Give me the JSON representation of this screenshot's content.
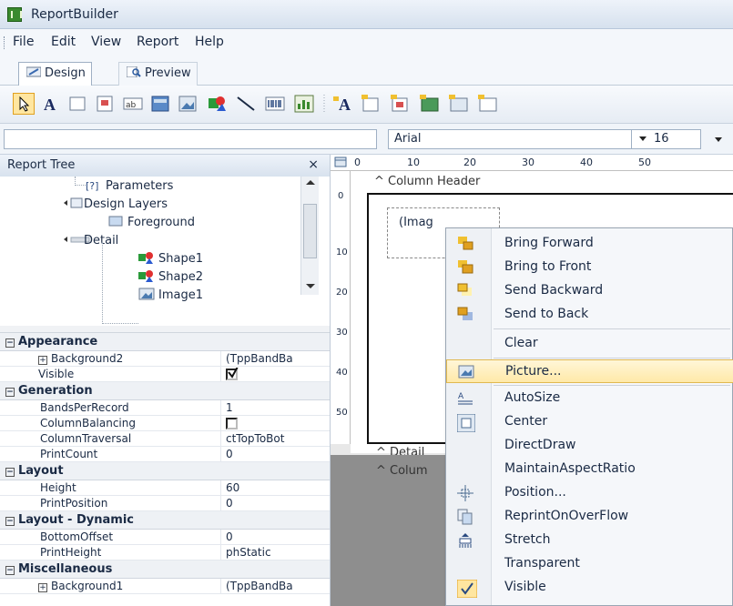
{
  "window": {
    "title": "ReportBuilder"
  },
  "menu": [
    "File",
    "Edit",
    "View",
    "Report",
    "Help"
  ],
  "tabs": [
    {
      "label": "Design",
      "active": true
    },
    {
      "label": "Preview",
      "active": false
    }
  ],
  "toolbar": {
    "font_name": "Arial",
    "font_size": "16",
    "tools": [
      "pointer-icon",
      "label-icon",
      "edit-icon",
      "memo-icon",
      "dbtext-icon",
      "dbcalc-icon",
      "image-icon",
      "shape-icon",
      "line-icon",
      "barcode-icon",
      "chart-icon",
      "region-icon",
      "subreport-icon",
      "crossTab-icon",
      "richtext-icon",
      "variable-icon"
    ]
  },
  "report_tree": {
    "title": "Report Tree",
    "close_label": "×",
    "nodes": [
      "Parameters",
      "Design Layers",
      "Foreground",
      "Detail",
      "Shape1",
      "Shape2",
      "Image1"
    ]
  },
  "properties": {
    "categories": [
      {
        "name": "Appearance",
        "rows": [
          {
            "name": "Background2",
            "value": "(TppBandBa",
            "expandable": true
          },
          {
            "name": "Visible",
            "value": "",
            "checkbox": true,
            "checked": true
          }
        ]
      },
      {
        "name": "Generation",
        "rows": [
          {
            "name": "BandsPerRecord",
            "value": "1"
          },
          {
            "name": "ColumnBalancing",
            "value": "",
            "checkbox": true,
            "checked": false
          },
          {
            "name": "ColumnTraversal",
            "value": "ctTopToBot"
          },
          {
            "name": "PrintCount",
            "value": "0"
          }
        ]
      },
      {
        "name": "Layout",
        "rows": [
          {
            "name": "Height",
            "value": "60"
          },
          {
            "name": "PrintPosition",
            "value": "0"
          }
        ]
      },
      {
        "name": "Layout - Dynamic",
        "rows": [
          {
            "name": "BottomOffset",
            "value": "0"
          },
          {
            "name": "PrintHeight",
            "value": "phStatic"
          }
        ]
      },
      {
        "name": "Miscellaneous",
        "rows": [
          {
            "name": "Background1",
            "value": "(TppBandBa",
            "expandable": true
          }
        ]
      }
    ]
  },
  "ruler": {
    "top_labels": [
      "0",
      "10",
      "20",
      "30",
      "40",
      "50"
    ],
    "left_labels": [
      "0",
      "10",
      "20",
      "30",
      "40",
      "50"
    ]
  },
  "design": {
    "column_header_label": "Column Header",
    "image_placeholder": "(Imag",
    "detail_label": "Detail",
    "column_footer_label": "Colum"
  },
  "context_menu": {
    "items": [
      {
        "label": "Bring Forward",
        "icon": "bring-forward-icon"
      },
      {
        "label": "Bring to Front",
        "icon": "bring-front-icon"
      },
      {
        "label": "Send Backward",
        "icon": "send-backward-icon"
      },
      {
        "label": "Send to Back",
        "icon": "send-back-icon"
      },
      {
        "label": "Clear",
        "icon": ""
      },
      {
        "label": "Picture...",
        "icon": "picture-icon",
        "highlighted": true
      },
      {
        "label": "AutoSize",
        "icon": "autosize-icon"
      },
      {
        "label": "Center",
        "icon": "center-icon"
      },
      {
        "label": "DirectDraw",
        "icon": ""
      },
      {
        "label": "MaintainAspectRatio",
        "icon": ""
      },
      {
        "label": "Position...",
        "icon": "position-icon"
      },
      {
        "label": "ReprintOnOverFlow",
        "icon": "reprint-icon"
      },
      {
        "label": "Stretch",
        "icon": "stretch-icon"
      },
      {
        "label": "Transparent",
        "icon": ""
      },
      {
        "label": "Visible",
        "icon": "visible-icon"
      }
    ]
  }
}
